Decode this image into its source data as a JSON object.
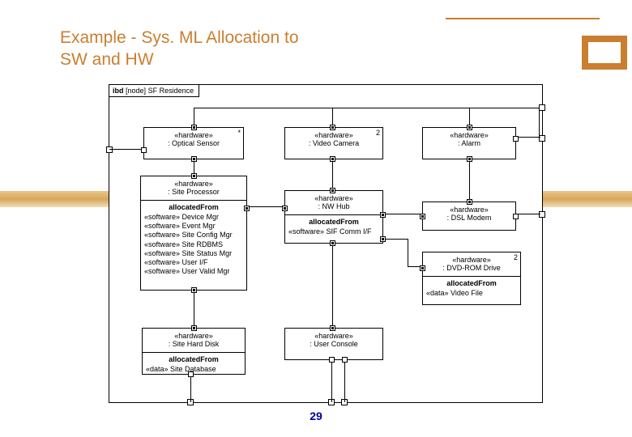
{
  "title_line1": "Example - Sys. ML Allocation to",
  "title_line2": "SW and HW",
  "page_number": "29",
  "frame": {
    "type": "ibd",
    "kind": "[node]",
    "name": "SF Residence"
  },
  "blocks": {
    "optical": {
      "stereotype": "«hardware»",
      "name": ": Optical Sensor",
      "mult": "*"
    },
    "camera": {
      "stereotype": "«hardware»",
      "name": ": Video Camera",
      "mult": "2"
    },
    "alarm": {
      "stereotype": "«hardware»",
      "name": ": Alarm"
    },
    "processor": {
      "stereotype": "«hardware»",
      "name": ": Site Processor",
      "alloc_label": "allocatedFrom",
      "allocs": [
        {
          "st": "«software»",
          "n": "Device Mgr"
        },
        {
          "st": "«software»",
          "n": "Event Mgr"
        },
        {
          "st": "«software»",
          "n": "Site Config Mgr"
        },
        {
          "st": "«software»",
          "n": "Site RDBMS"
        },
        {
          "st": "«software»",
          "n": "Site Status Mgr"
        },
        {
          "st": "«software»",
          "n": "User I/F"
        },
        {
          "st": "«software»",
          "n": "User Valid Mgr"
        }
      ]
    },
    "nwhub": {
      "stereotype": "«hardware»",
      "name": ": NW Hub",
      "alloc_label": "allocatedFrom",
      "allocs": [
        {
          "st": "«software»",
          "n": "SIF Comm I/F"
        }
      ]
    },
    "dsl": {
      "stereotype": "«hardware»",
      "name": ": DSL Modem"
    },
    "dvd": {
      "stereotype": "«hardware»",
      "name": ": DVD-ROM Drive",
      "mult": "2",
      "alloc_label": "allocatedFrom",
      "allocs": [
        {
          "st": "«data»",
          "n": "Video File"
        }
      ]
    },
    "disk": {
      "stereotype": "«hardware»",
      "name": ": Site Hard Disk",
      "alloc_label": "allocatedFrom",
      "allocs": [
        {
          "st": "«data»",
          "n": "Site Database"
        }
      ]
    },
    "console": {
      "stereotype": "«hardware»",
      "name": ": User Console"
    }
  }
}
